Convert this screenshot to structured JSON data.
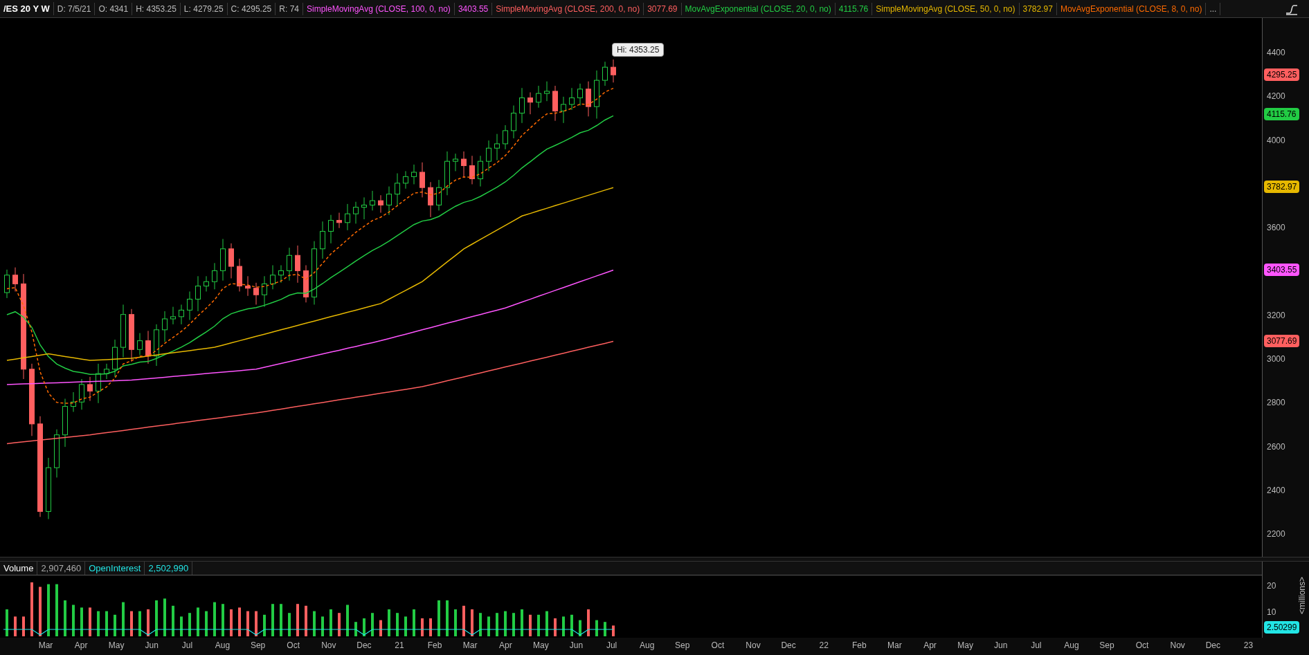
{
  "header": {
    "symbol": "/ES 20 Y W",
    "fields": [
      "D: 7/5/21",
      "O: 4341",
      "H: 4353.25",
      "L: 4279.25",
      "C: 4295.25",
      "R: 74"
    ],
    "studies": [
      {
        "name": "SimpleMovingAvg (CLOSE, 100, 0, no)",
        "value": "3403.55",
        "color": "#ff55ff"
      },
      {
        "name": "SimpleMovingAvg (CLOSE, 200, 0, no)",
        "value": "3077.69",
        "color": "#ff5f5f"
      },
      {
        "name": "MovAvgExponential (CLOSE, 20, 0, no)",
        "value": "4115.76",
        "color": "#22cc44"
      },
      {
        "name": "SimpleMovingAvg (CLOSE, 50, 0, no)",
        "value": "3782.97",
        "color": "#e6b800"
      },
      {
        "name": "MovAvgExponential (CLOSE, 8, 0, no)",
        "color": "#ff6a00"
      }
    ],
    "more": "..."
  },
  "price_chart": {
    "hi_label": "Hi: 4353.25",
    "ticks": [
      "4400",
      "4200",
      "4000",
      "3600",
      "3200",
      "3000",
      "2800",
      "2600",
      "2400",
      "2200"
    ],
    "badges": [
      {
        "value": "4295.25",
        "color": "#ff5f5f"
      },
      {
        "value": "4115.76",
        "color": "#22cc44"
      },
      {
        "value": "3782.97",
        "color": "#e6b800"
      },
      {
        "value": "3403.55",
        "color": "#ff55ff"
      },
      {
        "value": "3077.69",
        "color": "#ff5f5f"
      }
    ]
  },
  "volume": {
    "fields": [
      {
        "label": "Volume",
        "value": "2,907,460",
        "color": "#ffffff"
      },
      {
        "label": "OpenInterest",
        "value": "2,502,990",
        "color": "#22e5e5"
      }
    ],
    "ticks": [
      "20",
      "10"
    ],
    "badge": "2.50299",
    "unit": "<millions>"
  },
  "x_axis": [
    "Mar",
    "Apr",
    "May",
    "Jun",
    "Jul",
    "Aug",
    "Sep",
    "Oct",
    "Nov",
    "Dec",
    "21",
    "Feb",
    "Mar",
    "Apr",
    "May",
    "Jun",
    "Jul",
    "Aug",
    "Sep",
    "Oct",
    "Nov",
    "Dec",
    "22",
    "Feb",
    "Mar",
    "Apr",
    "May",
    "Jun",
    "Jul",
    "Aug",
    "Sep",
    "Oct",
    "Nov",
    "Dec",
    "23"
  ]
}
